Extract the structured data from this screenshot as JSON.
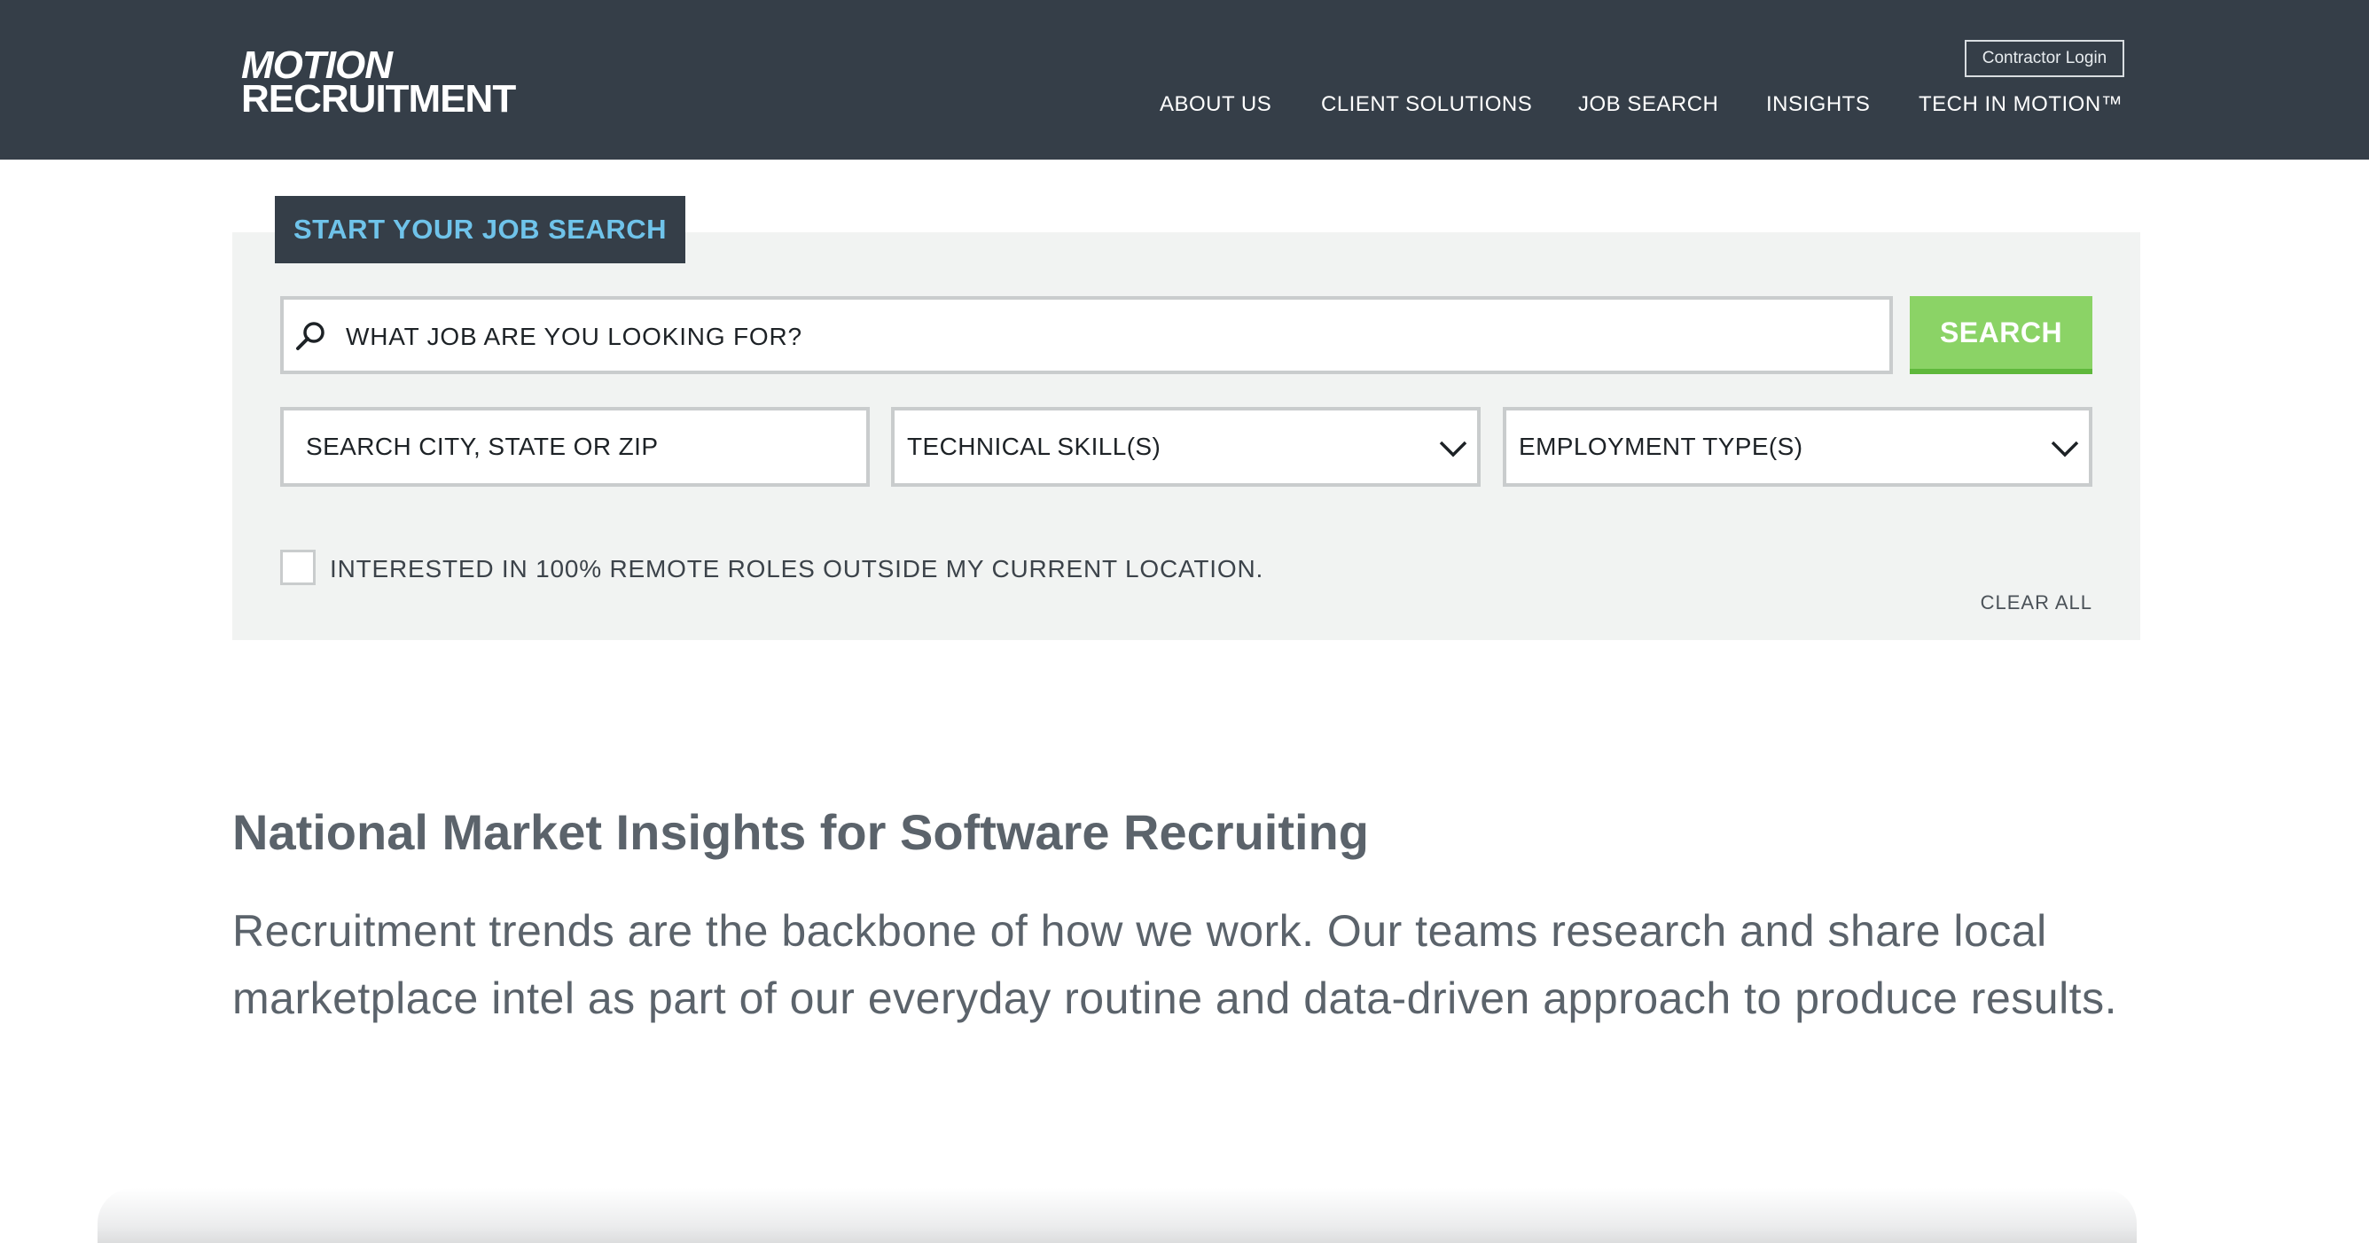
{
  "header": {
    "logo": {
      "line1": "MOTION",
      "line2": "RECRUITMENT"
    },
    "contractor_login": "Contractor Login",
    "nav": [
      {
        "label": "ABOUT US"
      },
      {
        "label": "CLIENT SOLUTIONS"
      },
      {
        "label": "JOB SEARCH"
      },
      {
        "label": "INSIGHTS"
      },
      {
        "label": "TECH IN MOTION™"
      }
    ]
  },
  "job_search": {
    "tab_label": "START YOUR JOB SEARCH",
    "search_placeholder": "WHAT JOB ARE YOU LOOKING FOR?",
    "search_button": "SEARCH",
    "location_placeholder": "SEARCH CITY, STATE OR ZIP",
    "skills_select": "TECHNICAL SKILL(S)",
    "employment_select": "EMPLOYMENT TYPE(S)",
    "remote_checkbox_label": "INTERESTED IN 100% REMOTE ROLES OUTSIDE MY CURRENT LOCATION.",
    "clear_all": "CLEAR ALL"
  },
  "content": {
    "heading": "National Market Insights for Software Recruiting",
    "body": "Recruitment trends are the backbone of how we work. Our teams research and share local marketplace intel as part of our everyday routine and data-driven approach to produce results."
  },
  "colors": {
    "header_bg": "#353e48",
    "tab_text": "#6fc3ea",
    "search_button_bg": "#8bd366",
    "panel_bg": "#f1f3f2",
    "text_gray": "#5b636b"
  },
  "icons": {
    "search": "search-icon",
    "dropdown": "chevron-down-icon"
  }
}
